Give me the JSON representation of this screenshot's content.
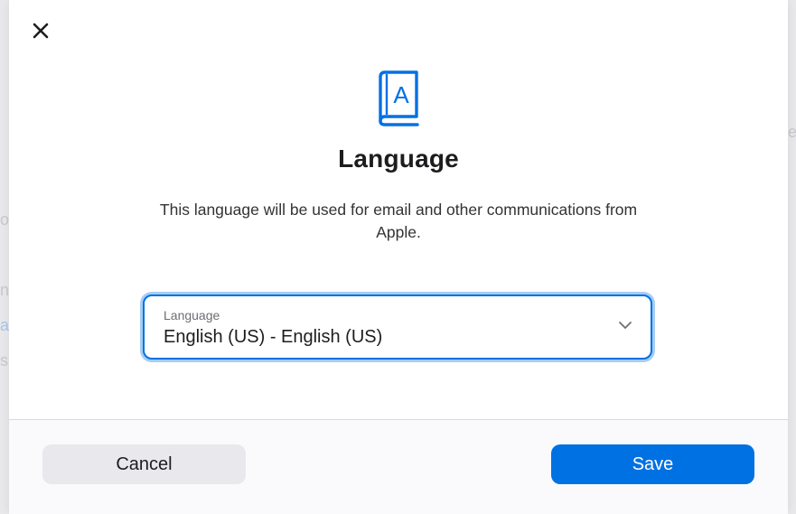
{
  "dialog": {
    "title": "Language",
    "description": "This language will be used for email and other communications from Apple.",
    "header_icon": "book-a-icon",
    "close_icon": "close-icon"
  },
  "language_select": {
    "label": "Language",
    "value": "English (US) - English (US)",
    "chevron_icon": "chevron-down-icon"
  },
  "footer": {
    "cancel_label": "Cancel",
    "save_label": "Save"
  },
  "colors": {
    "accent": "#0071e3",
    "cancel_bg": "#e8e8ed",
    "page_bg": "#ffffff"
  }
}
